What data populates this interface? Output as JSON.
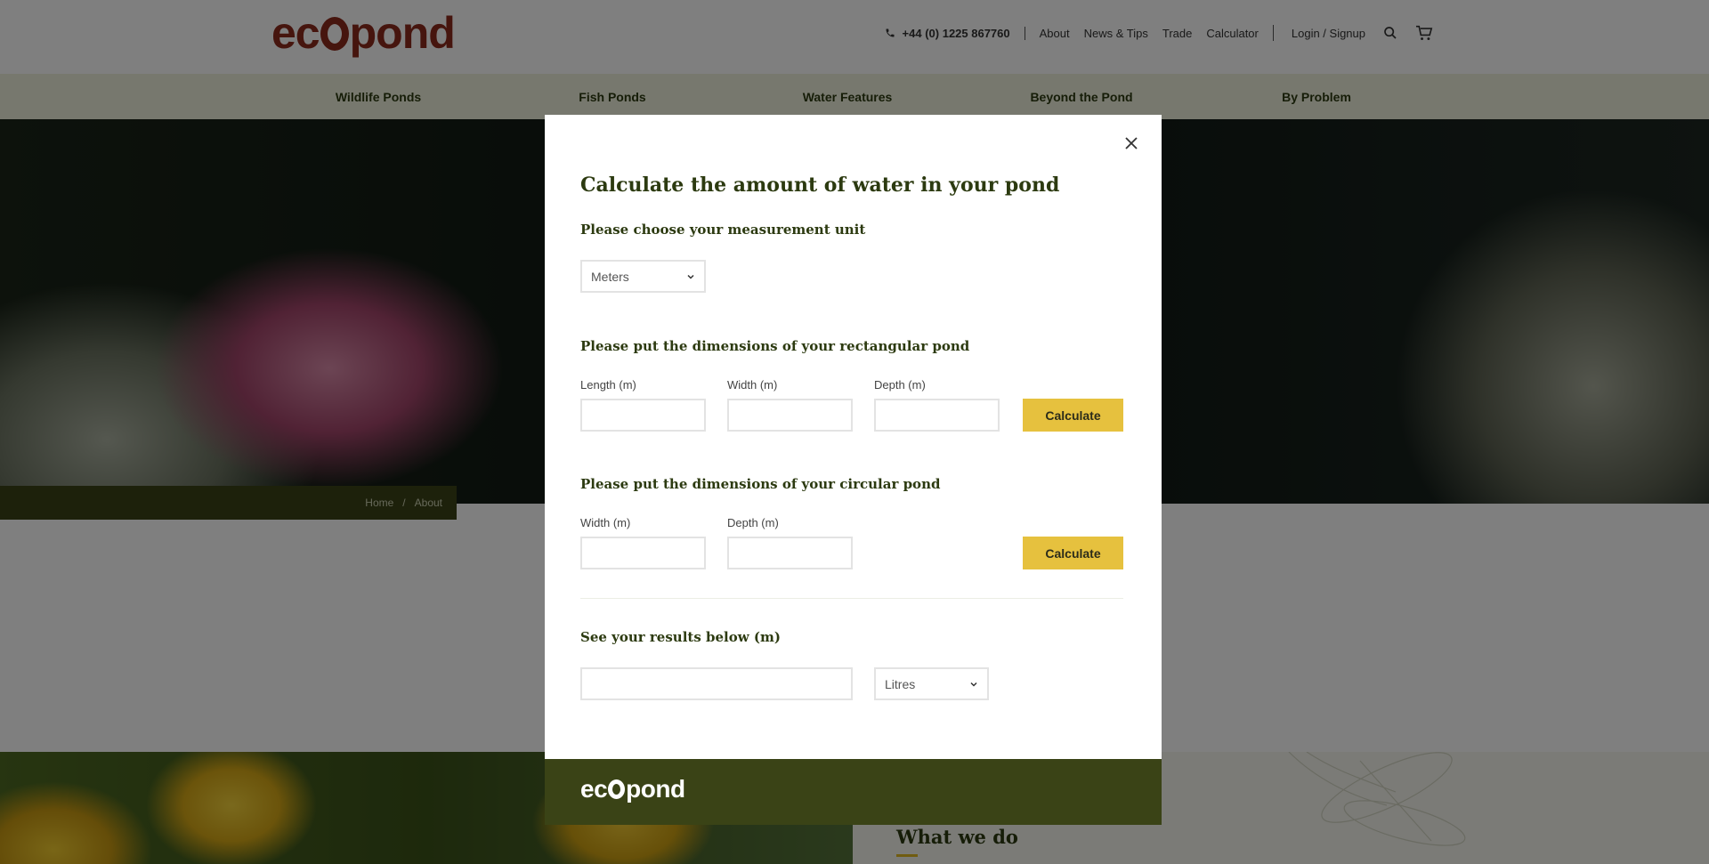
{
  "header": {
    "logo_text_pre": "ec",
    "logo_text_post": "pond",
    "phone": "+44 (0) 1225 867760",
    "links": [
      "About",
      "News & Tips",
      "Trade",
      "Calculator"
    ],
    "login": "Login / Signup"
  },
  "nav": {
    "items": [
      "Wildlife Ponds",
      "Fish Ponds",
      "Water Features",
      "Beyond the Pond",
      "By Problem"
    ]
  },
  "breadcrumb": {
    "home": "Home",
    "separator": "/",
    "current": "About"
  },
  "lower": {
    "heading": "What we do"
  },
  "modal": {
    "title": "Calculate the amount of water in your pond",
    "unit_section": "Please choose your measurement unit",
    "unit_selected": "Meters",
    "rect_section": "Please put the dimensions of your rectangular pond",
    "rect_length_label": "Length (m)",
    "rect_width_label": "Width (m)",
    "rect_depth_label": "Depth (m)",
    "calc_label": "Calculate",
    "circ_section": "Please put the dimensions of your circular pond",
    "circ_width_label": "Width (m)",
    "circ_depth_label": "Depth (m)",
    "results_section": "See your results below (m)",
    "result_value": "",
    "result_unit_selected": "Litres",
    "footer_logo_pre": "ec",
    "footer_logo_post": "pond"
  },
  "colors": {
    "brand_dark": "#3a4316",
    "brand_red": "#8c2a1c",
    "accent_yellow": "#e6c13e",
    "heading_text": "#2c3a10"
  }
}
